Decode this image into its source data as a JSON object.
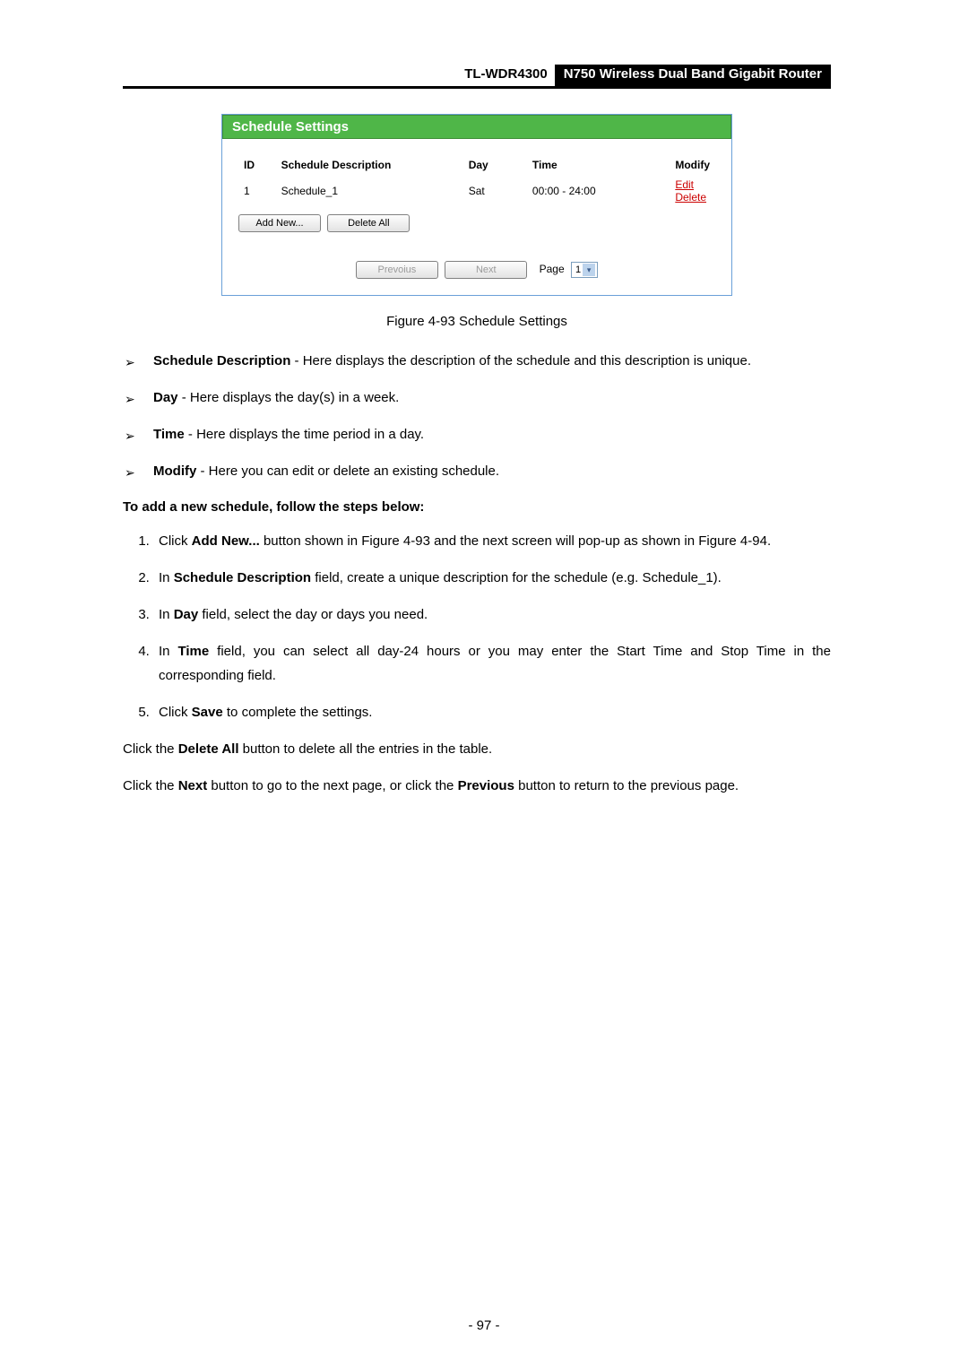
{
  "header": {
    "model": "TL-WDR4300",
    "product": "N750 Wireless Dual Band Gigabit Router"
  },
  "panel": {
    "title": "Schedule Settings",
    "cols": {
      "id": "ID",
      "desc": "Schedule Description",
      "day": "Day",
      "time": "Time",
      "modify": "Modify"
    },
    "rows": [
      {
        "id": "1",
        "desc": "Schedule_1",
        "day": "Sat",
        "time": "00:00 - 24:00",
        "edit": "Edit",
        "del": "Delete"
      }
    ],
    "buttons": {
      "add": "Add New...",
      "delall": "Delete All",
      "prev": "Prevoius",
      "next": "Next"
    },
    "pager": {
      "label": "Page",
      "value": "1"
    }
  },
  "caption": "Figure 4-93 Schedule Settings",
  "bullets": [
    {
      "term": "Schedule Description",
      "rest": " - Here displays the description of the schedule and this description is unique."
    },
    {
      "term": "Day",
      "rest": " - Here displays the day(s) in a week."
    },
    {
      "term": "Time",
      "rest": " - Here displays the time period in a day."
    },
    {
      "term": "Modify",
      "rest": " - Here you can edit or delete an existing schedule."
    }
  ],
  "subhead": "To add a new schedule, follow the steps below:",
  "steps": {
    "s1a": "Click ",
    "s1b": "Add New...",
    "s1c": " button shown in Figure 4-93 and the next screen will pop-up as shown in Figure 4-94.",
    "s2a": "In ",
    "s2b": "Schedule Description",
    "s2c": " field, create a unique description for the schedule (e.g. Schedule_1).",
    "s3a": "In ",
    "s3b": "Day",
    "s3c": " field, select the day or days you need.",
    "s4a": "In ",
    "s4b": "Time",
    "s4c": " field, you can select all day-24 hours or you may enter the Start Time and Stop Time in the corresponding field.",
    "s5a": "Click ",
    "s5b": "Save",
    "s5c": " to complete the settings."
  },
  "para1": {
    "a": "Click the ",
    "b": "Delete All",
    "c": " button to delete all the entries in the table."
  },
  "para2": {
    "a": "Click the ",
    "b": "Next",
    "c": " button to go to the next page, or click the ",
    "d": "Previous",
    "e": " button to return to the previous page."
  },
  "footer": "- 97 -"
}
